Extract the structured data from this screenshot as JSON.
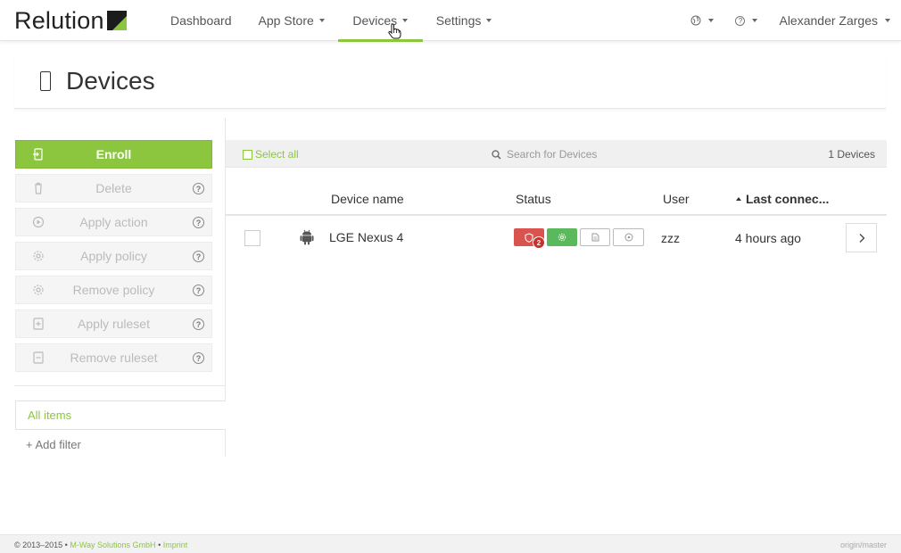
{
  "brand": {
    "name": "Relution"
  },
  "nav": {
    "items": [
      {
        "label": "Dashboard",
        "has_caret": false
      },
      {
        "label": "App Store",
        "has_caret": true
      },
      {
        "label": "Devices",
        "has_caret": true,
        "active": true
      },
      {
        "label": "Settings",
        "has_caret": true
      }
    ],
    "right": {
      "language_icon": "globe-icon",
      "help_icon": "help-icon",
      "user_name": "Alexander Zarges"
    }
  },
  "page": {
    "title": "Devices",
    "icon": "mobile-device-icon"
  },
  "sidebar": {
    "enroll_label": "Enroll",
    "actions": [
      {
        "label": "Delete",
        "icon": "trash-icon"
      },
      {
        "label": "Apply action",
        "icon": "play-icon"
      },
      {
        "label": "Apply policy",
        "icon": "gear-icon"
      },
      {
        "label": "Remove policy",
        "icon": "gear-icon"
      },
      {
        "label": "Apply ruleset",
        "icon": "plus-square-icon"
      },
      {
        "label": "Remove ruleset",
        "icon": "minus-square-icon"
      }
    ],
    "filters": {
      "all_items": "All items",
      "add_filter": "+ Add filter"
    }
  },
  "toolbar": {
    "select_all": "Select all",
    "search_placeholder": "Search for Devices",
    "device_count": "1 Devices"
  },
  "table": {
    "headers": {
      "device_name": "Device name",
      "status": "Status",
      "user": "User",
      "last_connected": "Last connec..."
    },
    "rows": [
      {
        "platform_icon": "android-icon",
        "device_name": "LGE Nexus 4",
        "status_badges": [
          {
            "icon": "shield-icon",
            "color": "#d9534f",
            "count": "2"
          },
          {
            "icon": "gear-icon",
            "color": "#5cb85c"
          },
          {
            "icon": "file-icon",
            "color": "#ffffff"
          },
          {
            "icon": "target-icon",
            "color": "#ffffff"
          }
        ],
        "user": "zzz",
        "last_connected": "4 hours ago"
      }
    ]
  },
  "footer": {
    "copyright": "© 2013–2015 •",
    "company": "M-Way Solutions GmbH",
    "separator": "•",
    "imprint": "Imprint",
    "branch": "origin/master"
  },
  "colors": {
    "accent": "#8cc63f",
    "danger": "#d9534f",
    "success": "#5cb85c"
  }
}
